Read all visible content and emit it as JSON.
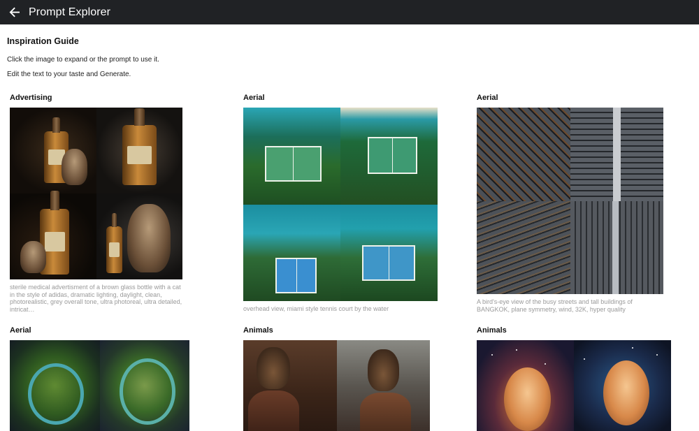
{
  "app": {
    "title": "Prompt Explorer"
  },
  "guide": {
    "title": "Inspiration Guide",
    "instructions": [
      "Click the image to expand or the prompt to use it.",
      "Edit the text to your taste and Generate."
    ]
  },
  "cards": [
    {
      "category": "Advertising",
      "prompt": "sterile medical advertisment of a brown glass bottle with a cat in the style of adidas, dramatic lighting, daylight, clean, photorealistic, grey overall tone, ultra photoreal, ultra detailed, intricat…"
    },
    {
      "category": "Aerial",
      "prompt": "overhead view, miami style tennis court by the water"
    },
    {
      "category": "Aerial",
      "prompt": "A bird's-eye view of the busy streets and tall buildings of BANGKOK, plane symmetry, wind, 32K, hyper quality"
    },
    {
      "category": "Aerial",
      "prompt": ""
    },
    {
      "category": "Animals",
      "prompt": ""
    },
    {
      "category": "Animals",
      "prompt": ""
    }
  ]
}
